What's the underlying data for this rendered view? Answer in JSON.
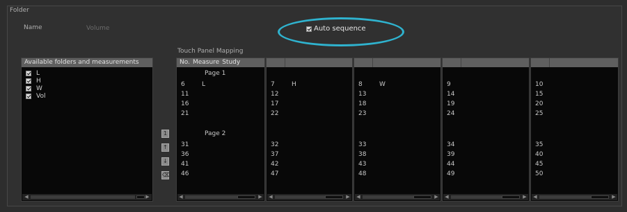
{
  "folder": {
    "title": "Folder",
    "name_label": "Name",
    "name_value": "Volume"
  },
  "auto_sequence": {
    "label": "Auto sequence",
    "checked": true
  },
  "available": {
    "header": "Available folders and measurements",
    "items": [
      {
        "label": "L",
        "checked": true
      },
      {
        "label": "H",
        "checked": true
      },
      {
        "label": "W",
        "checked": true
      },
      {
        "label": "Vol",
        "checked": true
      }
    ]
  },
  "touch_panel": {
    "title": "Touch Panel Mapping",
    "col1_header": {
      "no": "No.",
      "measure": "Measure",
      "study": "Study"
    },
    "page1_label": "Page 1",
    "page2_label": "Page 2",
    "columns": [
      {
        "page1": [
          {
            "no": "6",
            "measure": "L"
          },
          {
            "no": "11",
            "measure": ""
          },
          {
            "no": "16",
            "measure": ""
          },
          {
            "no": "21",
            "measure": ""
          }
        ],
        "page2": [
          {
            "no": "31"
          },
          {
            "no": "36"
          },
          {
            "no": "41"
          },
          {
            "no": "46"
          }
        ]
      },
      {
        "page1": [
          {
            "no": "7",
            "measure": "H"
          },
          {
            "no": "12",
            "measure": ""
          },
          {
            "no": "17",
            "measure": ""
          },
          {
            "no": "22",
            "measure": ""
          }
        ],
        "page2": [
          {
            "no": "32"
          },
          {
            "no": "37"
          },
          {
            "no": "42"
          },
          {
            "no": "47"
          }
        ]
      },
      {
        "page1": [
          {
            "no": "8",
            "measure": "W"
          },
          {
            "no": "13",
            "measure": ""
          },
          {
            "no": "18",
            "measure": ""
          },
          {
            "no": "23",
            "measure": ""
          }
        ],
        "page2": [
          {
            "no": "33"
          },
          {
            "no": "38"
          },
          {
            "no": "43"
          },
          {
            "no": "48"
          }
        ]
      },
      {
        "page1": [
          {
            "no": "9",
            "measure": ""
          },
          {
            "no": "14",
            "measure": ""
          },
          {
            "no": "19",
            "measure": ""
          },
          {
            "no": "24",
            "measure": ""
          }
        ],
        "page2": [
          {
            "no": "34"
          },
          {
            "no": "39"
          },
          {
            "no": "44"
          },
          {
            "no": "49"
          }
        ]
      },
      {
        "page1": [
          {
            "no": "10",
            "measure": ""
          },
          {
            "no": "15",
            "measure": ""
          },
          {
            "no": "20",
            "measure": ""
          },
          {
            "no": "25",
            "measure": ""
          }
        ],
        "page2": [
          {
            "no": "35"
          },
          {
            "no": "40"
          },
          {
            "no": "45"
          },
          {
            "no": "50"
          }
        ]
      }
    ]
  },
  "page_buttons": [
    {
      "icon": "page-first-icon",
      "glyph": "1"
    },
    {
      "icon": "page-up-icon",
      "glyph": "↑"
    },
    {
      "icon": "page-down-icon",
      "glyph": "↓"
    },
    {
      "icon": "remove-icon",
      "glyph": "⌫"
    }
  ],
  "colors": {
    "highlight_ellipse": "#2fb3cf",
    "header_bg": "#5f5f5f",
    "panel_bg": "#080808"
  }
}
